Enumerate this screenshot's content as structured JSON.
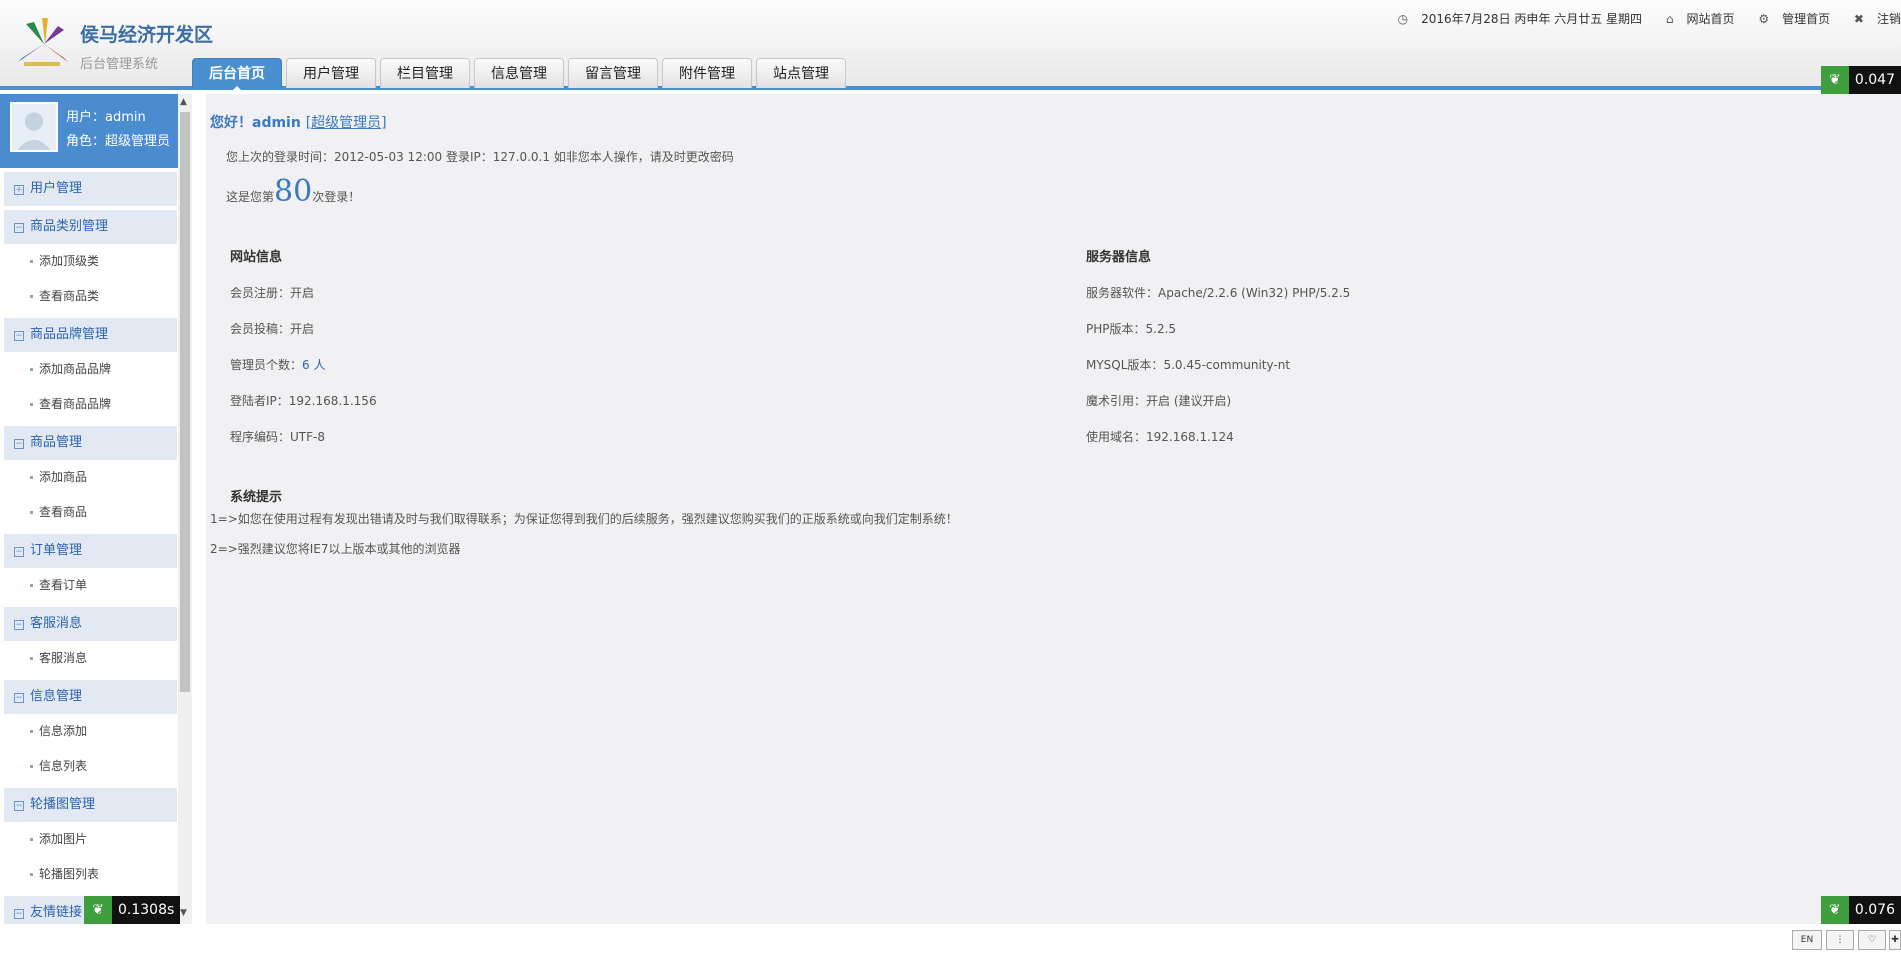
{
  "header": {
    "title": "侯马经济开发区",
    "subtitle": "后台管理系统",
    "date": "2016年7月28日 丙申年 六月廿五 星期四",
    "site_home": "网站首页",
    "admin_home": "管理首页",
    "logout": "注销",
    "tabs": [
      "后台首页",
      "用户管理",
      "栏目管理",
      "信息管理",
      "留言管理",
      "附件管理",
      "站点管理"
    ]
  },
  "sidebar": {
    "user_line": "用户：admin",
    "role_line": "角色：超级管理员",
    "menu": [
      {
        "label": "用户管理",
        "items": []
      },
      {
        "label": "商品类别管理",
        "items": [
          "添加顶级类",
          "查看商品类"
        ]
      },
      {
        "label": "商品品牌管理",
        "items": [
          "添加商品品牌",
          "查看商品品牌"
        ]
      },
      {
        "label": "商品管理",
        "items": [
          "添加商品",
          "查看商品"
        ]
      },
      {
        "label": "订单管理",
        "items": [
          "查看订单"
        ]
      },
      {
        "label": "客服消息",
        "items": [
          "客服消息"
        ]
      },
      {
        "label": "信息管理",
        "items": [
          "信息添加",
          "信息列表"
        ]
      },
      {
        "label": "轮播图管理",
        "items": [
          "添加图片",
          "轮播图列表"
        ]
      },
      {
        "label": "友情链接",
        "items": []
      }
    ]
  },
  "main": {
    "greeting": "您好！admin",
    "role_link": "[超级管理员]",
    "last_login": "您上次的登录时间：2012-05-03 12:00 登录IP：127.0.0.1      如非您本人操作，请及时更改密码",
    "login_prefix": "这是您第",
    "login_count": "80",
    "login_suffix": "次登录！",
    "site_info_title": "网站信息",
    "site_info": [
      {
        "label": "会员注册：",
        "value": "开启"
      },
      {
        "label": "会员投稿：",
        "value": "开启"
      },
      {
        "label": "管理员个数：",
        "value": "6 人"
      },
      {
        "label": "登陆者IP：",
        "value": "192.168.1.156"
      },
      {
        "label": "程序编码：",
        "value": "UTF-8"
      }
    ],
    "server_info_title": "服务器信息",
    "server_info": [
      {
        "label": "服务器软件：",
        "value": "Apache/2.2.6 (Win32) PHP/5.2.5"
      },
      {
        "label": "PHP版本：",
        "value": "5.2.5"
      },
      {
        "label": "MYSQL版本：",
        "value": "5.0.45-community-nt"
      },
      {
        "label": "魔术引用：",
        "value": "开启 (建议开启)"
      },
      {
        "label": "使用域名：",
        "value": "192.168.1.124"
      }
    ],
    "tips_title": "系统提示",
    "tips": [
      "1=>如您在使用过程有发现出错请及时与我们取得联系；为保证您得到我们的后续服务，强烈建议您购买我们的正版系统或向我们定制系统！",
      "2=>强烈建议您将IE7以上版本或其他的浏览器"
    ]
  },
  "badges": {
    "top_right": "0.047",
    "bottom_left": "0.1308s",
    "bottom_right": "0.076"
  },
  "taskbar": {
    "lang": "EN"
  },
  "colors": {
    "accent": "#4a90d0",
    "link": "#3a7ac0"
  }
}
